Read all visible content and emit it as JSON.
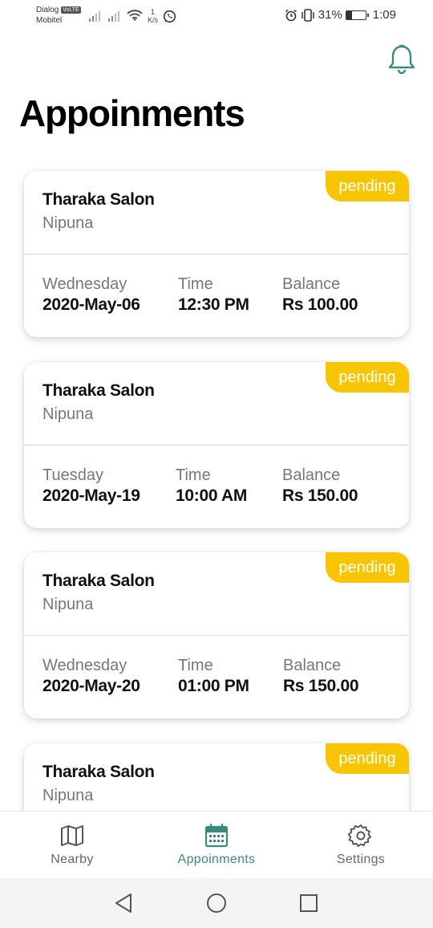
{
  "status_bar": {
    "carrier1": "Dialog",
    "volte": "VoLTE",
    "carrier2": "Mobitel",
    "net_speed_value": "1",
    "net_speed_unit": "K/s",
    "battery_percent": "31%",
    "battery_level": 0.31,
    "time": "1:09"
  },
  "header": {
    "title": "Appoinments",
    "bell_icon": "bell-icon",
    "accent_color": "#3a8a80"
  },
  "appointments": [
    {
      "salon": "Tharaka Salon",
      "stylist": "Nipuna",
      "status": "pending",
      "day_label": "Wednesday",
      "date": "2020-May-06",
      "time_label": "Time",
      "time": "12:30 PM",
      "balance_label": "Balance",
      "balance": "Rs 100.00"
    },
    {
      "salon": "Tharaka Salon",
      "stylist": "Nipuna",
      "status": "pending",
      "day_label": "Tuesday",
      "date": "2020-May-19",
      "time_label": "Time",
      "time": "10:00 AM",
      "balance_label": "Balance",
      "balance": "Rs 150.00"
    },
    {
      "salon": "Tharaka Salon",
      "stylist": "Nipuna",
      "status": "pending",
      "day_label": "Wednesday",
      "date": "2020-May-20",
      "time_label": "Time",
      "time": "01:00 PM",
      "balance_label": "Balance",
      "balance": "Rs 150.00"
    },
    {
      "salon": "Tharaka Salon",
      "stylist": "Nipuna",
      "status": "pending"
    }
  ],
  "status_color": "#f7c600",
  "bottom_nav": {
    "items": [
      {
        "label": "Nearby",
        "icon": "map-icon",
        "active": false
      },
      {
        "label": "Appoinments",
        "icon": "calendar-icon",
        "active": true
      },
      {
        "label": "Settings",
        "icon": "gear-icon",
        "active": false
      }
    ]
  },
  "system_nav": {
    "back_icon": "back-triangle-icon",
    "home_icon": "home-circle-icon",
    "recents_icon": "recents-square-icon"
  }
}
